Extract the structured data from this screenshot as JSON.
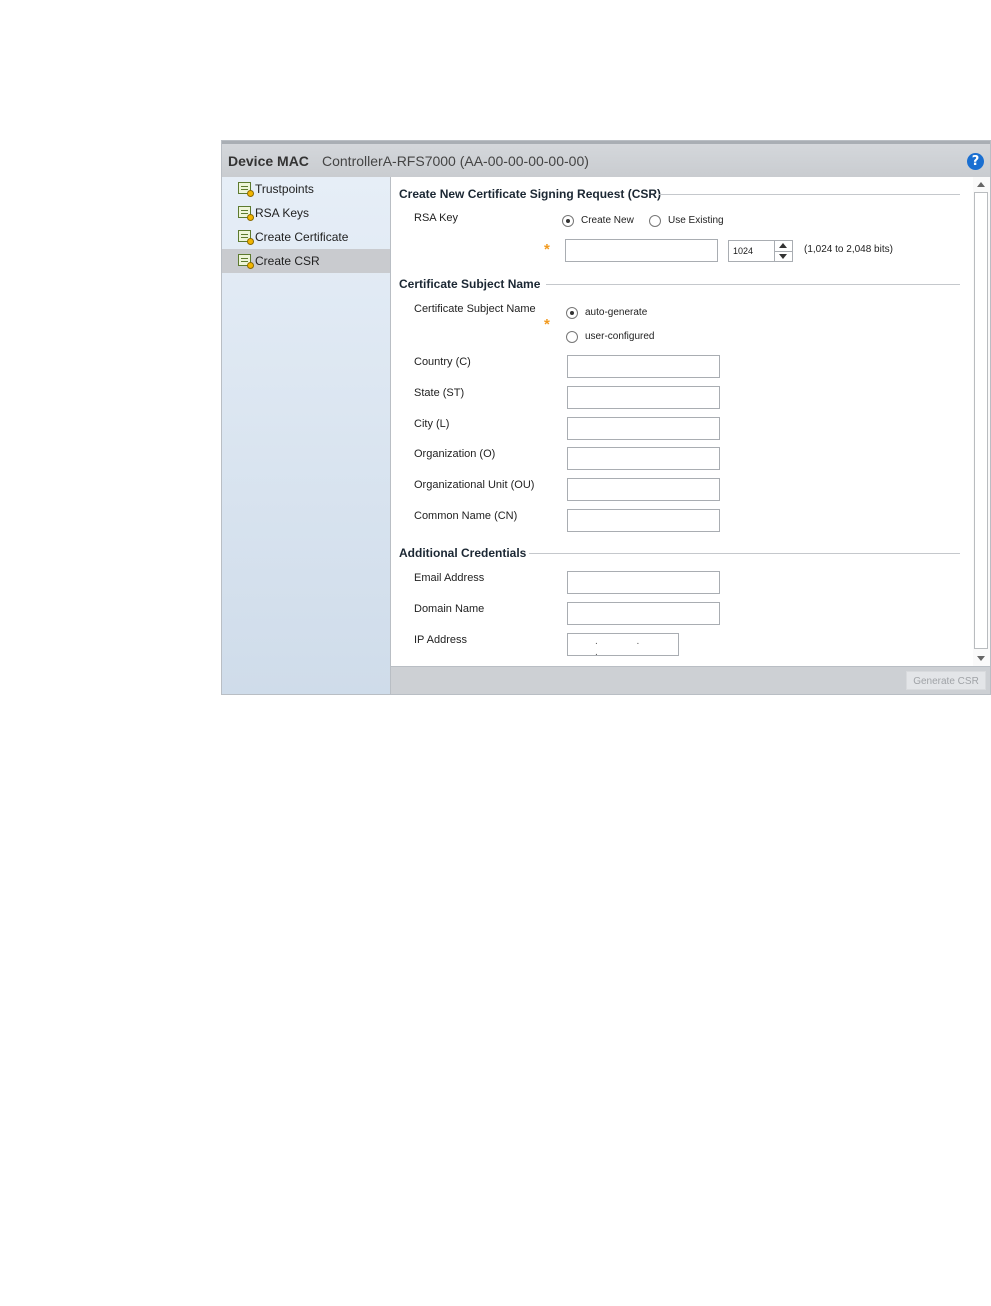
{
  "header": {
    "label": "Device MAC",
    "device": "ControllerA-RFS7000 (AA-00-00-00-00-00)",
    "help_glyph": "?"
  },
  "sidebar": {
    "items": [
      {
        "label": "Trustpoints",
        "icon": "certificate-icon"
      },
      {
        "label": "RSA Keys",
        "icon": "certificate-icon"
      },
      {
        "label": "Create Certificate",
        "icon": "certificate-icon"
      },
      {
        "label": "Create CSR",
        "icon": "certificate-icon",
        "selected": true
      }
    ]
  },
  "csr_section": {
    "title": "Create New Certificate Signing Request (CSR)",
    "rsa_key_label": "RSA Key",
    "create_new_label": "Create New",
    "use_existing_label": "Use Existing",
    "key_name_value": "",
    "key_size_value": "1024",
    "key_size_hint": "(1,024 to 2,048 bits)"
  },
  "subject_section": {
    "title": "Certificate Subject Name",
    "subject_label": "Certificate Subject Name",
    "auto_label": "auto-generate",
    "user_label": "user-configured",
    "fields": [
      {
        "label": "Country (C)",
        "value": ""
      },
      {
        "label": "State (ST)",
        "value": ""
      },
      {
        "label": "City (L)",
        "value": ""
      },
      {
        "label": "Organization (O)",
        "value": ""
      },
      {
        "label": "Organizational Unit (OU)",
        "value": ""
      },
      {
        "label": "Common Name (CN)",
        "value": ""
      }
    ]
  },
  "credentials_section": {
    "title": "Additional Credentials",
    "email_label": "Email Address",
    "domain_label": "Domain Name",
    "ip_label": "IP Address",
    "ip_placeholder": ". . ."
  },
  "footer": {
    "generate_label": "Generate CSR"
  },
  "colors": {
    "accent": "#1a6fd1",
    "required": "#f29a1f",
    "selected_nav": "#c9cbcf"
  }
}
